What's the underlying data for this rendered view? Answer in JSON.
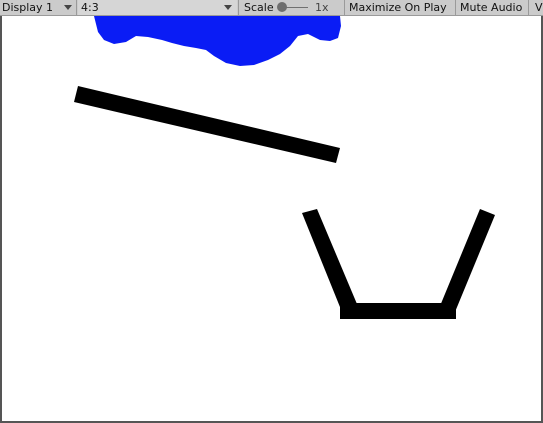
{
  "toolbar": {
    "display": "Display 1",
    "aspect": "4:3",
    "scale_label": "Scale",
    "scale_value": "1x",
    "maximize": "Maximize On Play",
    "mute": "Mute Audio",
    "overflow": "V"
  },
  "colors": {
    "liquid": "#0a1cf5",
    "shape": "#000000",
    "background": "#ffffff"
  }
}
